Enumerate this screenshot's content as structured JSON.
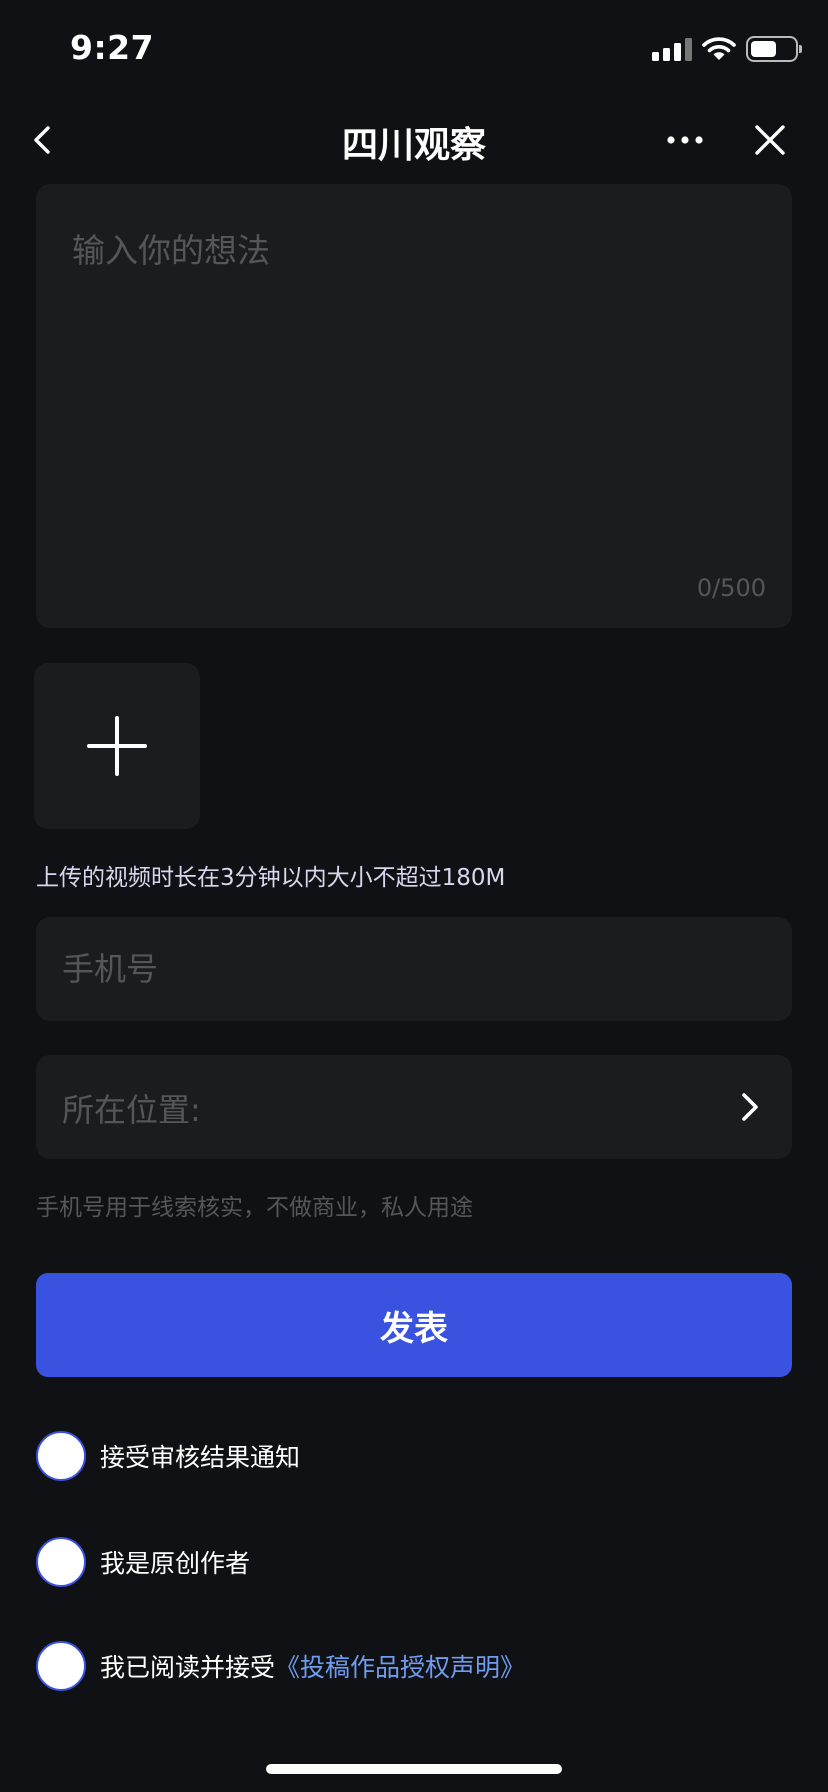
{
  "status_bar": {
    "time": "9:27",
    "icons": [
      "signal-icon",
      "wifi-icon",
      "battery-icon"
    ],
    "battery_level": 0.6
  },
  "nav": {
    "title": "四川观察",
    "back_icon": "chevron-left-icon",
    "more_icon": "more-icon",
    "close_icon": "close-icon"
  },
  "thought": {
    "placeholder": "输入你的想法",
    "value": "",
    "count": "0/500"
  },
  "upload": {
    "icon": "plus-icon",
    "hint": "上传的视频时长在3分钟以内大小不超过180M"
  },
  "phone": {
    "placeholder": "手机号",
    "value": ""
  },
  "location": {
    "label": "所在位置:",
    "icon": "chevron-right-icon"
  },
  "privacy_note": "手机号用于线索核实，不做商业，私人用途",
  "publish_label": "发表",
  "options": [
    {
      "label": "接受审核结果通知",
      "checked": false
    },
    {
      "label": "我是原创作者",
      "checked": false
    },
    {
      "label": "我已阅读并接受",
      "link": "《投稿作品授权声明》",
      "checked": false
    }
  ],
  "colors": {
    "background": "#101114",
    "card": "#1b1c1f",
    "accent": "#3a52e0",
    "link": "#6f9cf0",
    "muted": "#55565b"
  }
}
